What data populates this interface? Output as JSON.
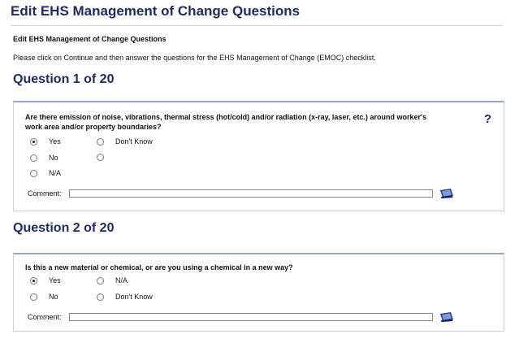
{
  "header": {
    "title": "Edit EHS Management of Change Questions",
    "subtitle": "Edit EHS Management of Change Questions",
    "instructions": "Please click on Continue and then answer the questions for the EHS Management of Change (EMOC) checklist."
  },
  "questions": [
    {
      "heading": "Question 1 of 20",
      "text": "Are there emission of noise, vibrations, thermal stress (hot/cold) and/or radiation (x-ray, laser, etc.) around worker's work area and/or property boundaries?",
      "help": "?",
      "options": [
        "Yes",
        "Don't Know",
        "No",
        "",
        "N/A"
      ],
      "selected": "Yes",
      "comment_label": "Comment:",
      "comment_value": ""
    },
    {
      "heading": "Question 2 of 20",
      "text": "Is this a new material or chemical, or are you using a chemical in a new way?",
      "options": [
        "Yes",
        "N/A",
        "No",
        "Don't Know"
      ],
      "selected": "Yes",
      "comment_label": "Comment:",
      "comment_value": ""
    }
  ],
  "icons": {
    "help": "question-mark-icon",
    "edit": "notepad-edit-icon"
  },
  "colors": {
    "heading": "#1f2a66",
    "box_border": "#c9cfe0"
  }
}
